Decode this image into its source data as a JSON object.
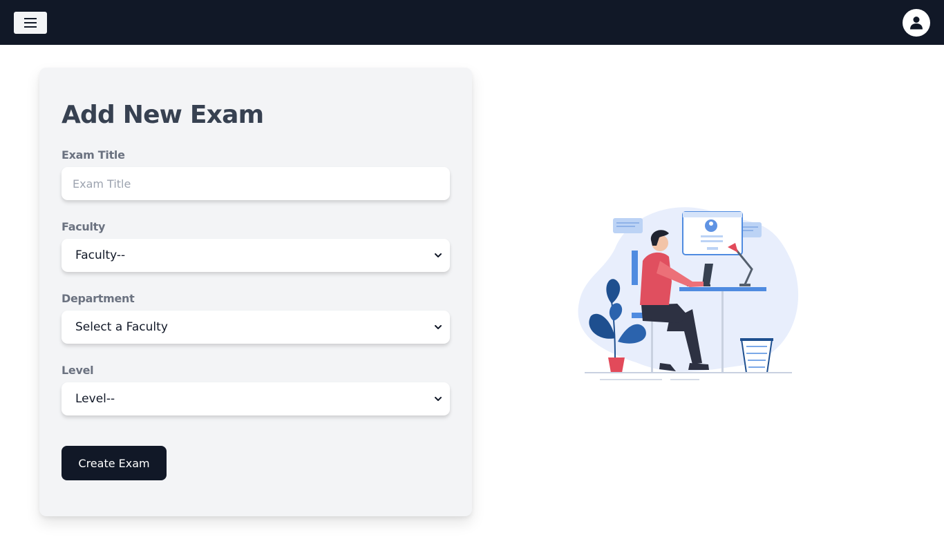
{
  "navbar": {
    "menu_icon": "hamburger-menu-icon",
    "profile_icon": "user-avatar-icon",
    "background_color": "#111827"
  },
  "form": {
    "heading": "Add New Exam",
    "exam_title": {
      "label": "Exam Title",
      "placeholder": "Exam Title",
      "value": ""
    },
    "faculty": {
      "label": "Faculty",
      "selected": "Faculty--"
    },
    "department": {
      "label": "Department",
      "selected": "Select a Faculty"
    },
    "level": {
      "label": "Level",
      "selected": "Level--"
    },
    "submit_label": "Create Exam"
  },
  "illustration": {
    "icon": "person-working-at-desk-illustration"
  },
  "colors": {
    "accent_dark": "#111827",
    "card_background": "#f3f4f6",
    "heading": "#374151",
    "label": "#6b7280"
  }
}
